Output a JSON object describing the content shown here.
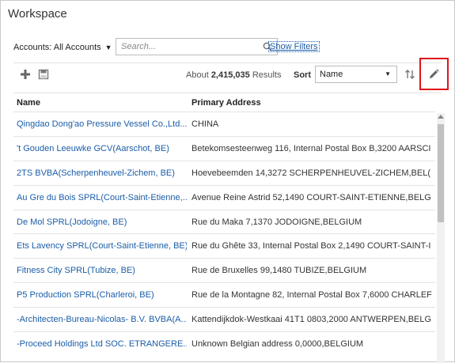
{
  "window": {
    "title": "Workspace"
  },
  "filters": {
    "accounts_label": "Accounts: All Accounts",
    "search_placeholder": "Search...",
    "search_value": "",
    "show_filters_label": "Show Filters"
  },
  "toolbar": {
    "results_prefix": "About",
    "results_count": "2,415,035",
    "results_suffix": "Results",
    "sort_label": "Sort",
    "sort_value": "Name",
    "icons": [
      "plus-icon",
      "export-icon",
      "sort-order-icon",
      "pencil-icon"
    ]
  },
  "table": {
    "columns": [
      "Name",
      "Primary Address"
    ],
    "rows": [
      {
        "name": "Qingdao Dong'ao Pressure Vessel Co.,Ltd....",
        "address": "CHINA"
      },
      {
        "name": "'t Gouden Leeuwke GCV(Aarschot, BE)",
        "address": "Betekomsesteenweg 116, Internal Postal Box B,3200 AARSCI"
      },
      {
        "name": "2TS BVBA(Scherpenheuvel-Zichem, BE)",
        "address": "Hoevebeemden 14,3272 SCHERPENHEUVEL-ZICHEM,BEL("
      },
      {
        "name": "Au Gre du Bois SPRL(Court-Saint-Etienne,...",
        "address": "Avenue Reine Astrid 52,1490 COURT-SAINT-ETIENNE,BELG"
      },
      {
        "name": "De Mol SPRL(Jodoigne, BE)",
        "address": "Rue du Maka 7,1370 JODOIGNE,BELGIUM"
      },
      {
        "name": "Ets Lavency SPRL(Court-Saint-Etienne, BE)",
        "address": "Rue du Ghête 33, Internal Postal Box 2,1490 COURT-SAINT-I"
      },
      {
        "name": "Fitness City SPRL(Tubize, BE)",
        "address": "Rue de Bruxelles 99,1480 TUBIZE,BELGIUM"
      },
      {
        "name": "P5 Production SPRL(Charleroi, BE)",
        "address": "Rue de la Montagne 82, Internal Postal Box 7,6000 CHARLEF"
      },
      {
        "name": "-Architecten-Bureau-Nicolas- B.V. BVBA(A...",
        "address": "Kattendijkdok-Westkaai 41T1 0803,2000 ANTWERPEN,BELG"
      },
      {
        "name": "-Proceed Holdings Ltd SOC. ETRANGERE...",
        "address": "Unknown Belgian address 0,0000,BELGIUM"
      }
    ]
  },
  "colors": {
    "link": "#1a5da8",
    "highlight_box": "#e0141a",
    "border": "#c9c9c9"
  }
}
